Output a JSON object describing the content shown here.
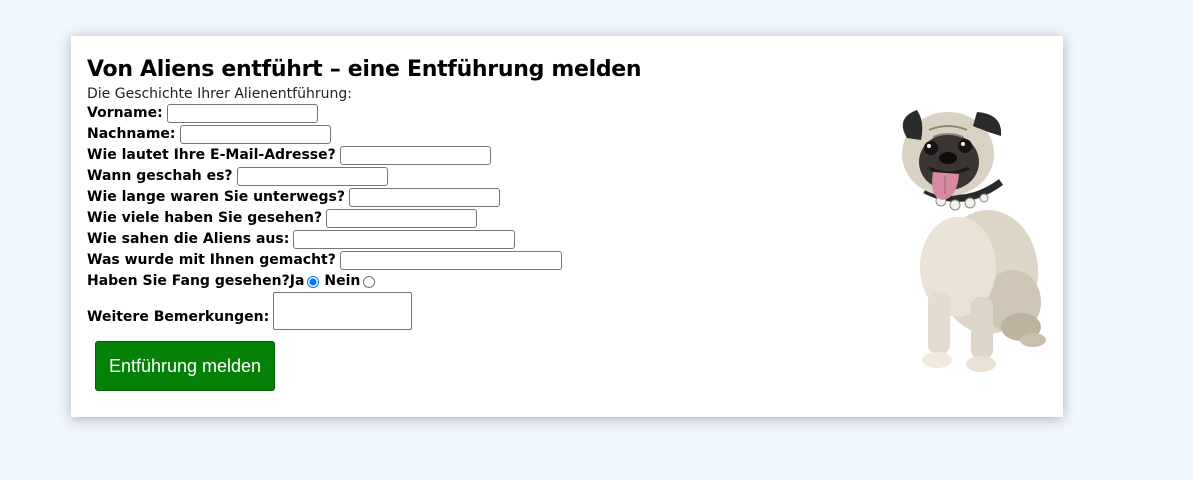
{
  "page": {
    "title": "Von Aliens entführt – eine Entführung melden",
    "intro": "Die Geschichte Ihrer Alienentführung:"
  },
  "form": {
    "fields": [
      {
        "label": "Vorname:",
        "value": ""
      },
      {
        "label": "Nachname:",
        "value": ""
      },
      {
        "label": "Wie lautet Ihre E-Mail-Adresse?",
        "value": ""
      },
      {
        "label": "Wann geschah es?",
        "value": ""
      },
      {
        "label": "Wie lange waren Sie unterwegs?",
        "value": ""
      },
      {
        "label": "Wie viele haben Sie gesehen?",
        "value": ""
      },
      {
        "label": "Wie sahen die Aliens aus:",
        "value": ""
      },
      {
        "label": "Was wurde mit Ihnen gemacht?",
        "value": ""
      }
    ],
    "fang": {
      "label": "Haben Sie Fang gesehen?",
      "option_yes": "Ja",
      "option_no": "Nein",
      "selected": "Ja"
    },
    "remarks": {
      "label": "Weitere Bemerkungen:",
      "value": ""
    },
    "submit_label": "Entführung melden"
  },
  "image": {
    "subject": "pug-dog"
  },
  "colors": {
    "page_background": "#f0f6fd",
    "card_background": "#ffffff",
    "submit_button": "#068107",
    "submit_text": "#ffffff"
  }
}
